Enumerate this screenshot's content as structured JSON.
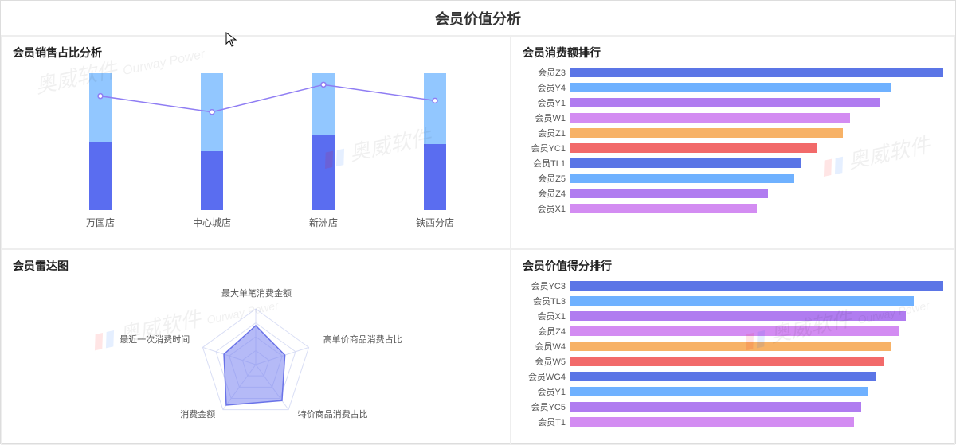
{
  "page_title": "会员价值分析",
  "panels": {
    "sales_ratio": {
      "title": "会员销售占比分析"
    },
    "spend_rank": {
      "title": "会员消费额排行"
    },
    "radar": {
      "title": "会员雷达图"
    },
    "value_rank": {
      "title": "会员价值得分排行"
    }
  },
  "watermark": {
    "cn": "奥威软件",
    "en": "Ourway Power"
  },
  "chart_data": [
    {
      "id": "sales_ratio",
      "type": "bar",
      "stacked": true,
      "categories": [
        "万国店",
        "中心城店",
        "新洲店",
        "铁西分店"
      ],
      "series": [
        {
          "name": "member_share",
          "values": [
            50,
            43,
            55,
            48
          ]
        },
        {
          "name": "nonmember_share",
          "values": [
            50,
            57,
            45,
            52
          ]
        }
      ],
      "overlay_line": {
        "name": "member_ratio_pct",
        "values": [
          100,
          86,
          110,
          96
        ]
      },
      "ylim": [
        0,
        100
      ],
      "title": "会员销售占比分析"
    },
    {
      "id": "spend_rank",
      "type": "bar",
      "orientation": "horizontal",
      "categories": [
        "会员Z3",
        "会员Y4",
        "会员Y1",
        "会员W1",
        "会员Z1",
        "会员YC1",
        "会员TL1",
        "会员Z5",
        "会员Z4",
        "会员X1"
      ],
      "values": [
        100,
        86,
        83,
        75,
        73,
        66,
        62,
        60,
        53,
        50
      ],
      "colors": [
        "#5b75e6",
        "#6fb1ff",
        "#b07cf0",
        "#d38cf2",
        "#f7b267",
        "#f26a6a",
        "#5b75e6",
        "#6fb1ff",
        "#b07cf0",
        "#d38cf2"
      ],
      "title": "会员消费额排行"
    },
    {
      "id": "radar",
      "type": "radar",
      "axes": [
        "最大单笔消费金额",
        "高单价商品消费占比",
        "特价商品消费占比",
        "消费金额",
        "最近一次消费时间"
      ],
      "series": [
        {
          "name": "member",
          "values": [
            0.7,
            0.55,
            0.8,
            0.9,
            0.6
          ]
        }
      ],
      "title": "会员雷达图"
    },
    {
      "id": "value_rank",
      "type": "bar",
      "orientation": "horizontal",
      "categories": [
        "会员YC3",
        "会员TL3",
        "会员X1",
        "会员Z4",
        "会员W4",
        "会员W5",
        "会员WG4",
        "会员Y1",
        "会员YC5",
        "会员T1"
      ],
      "values": [
        100,
        92,
        90,
        88,
        86,
        84,
        82,
        80,
        78,
        76
      ],
      "colors": [
        "#5b75e6",
        "#6fb1ff",
        "#b07cf0",
        "#d38cf2",
        "#f7b267",
        "#f26a6a",
        "#5b75e6",
        "#6fb1ff",
        "#b07cf0",
        "#d38cf2"
      ],
      "title": "会员价值得分排行"
    }
  ]
}
